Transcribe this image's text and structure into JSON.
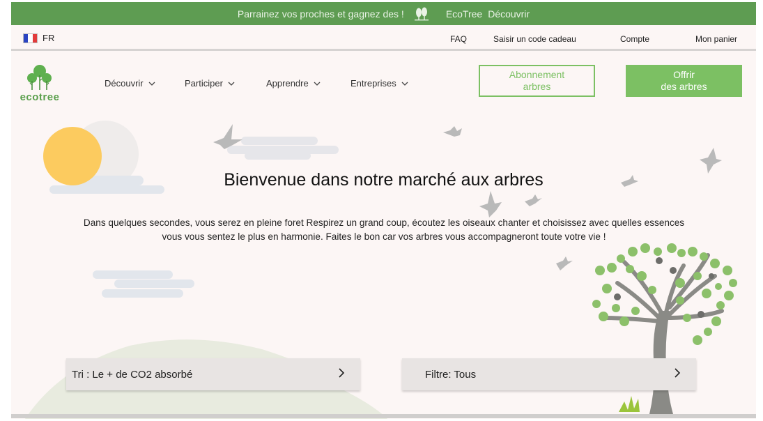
{
  "promo": {
    "text": "Parrainez vos proches et gagnez des !",
    "brand": "EcoTree",
    "link": "Découvrir"
  },
  "util": {
    "lang": "FR",
    "faq": "FAQ",
    "gift_code": "Saisir un code cadeau",
    "account": "Compte",
    "cart": "Mon panier"
  },
  "logo": {
    "text": "ecotree"
  },
  "nav": {
    "items": [
      {
        "label": "Découvrir"
      },
      {
        "label": "Participer"
      },
      {
        "label": "Apprendre"
      },
      {
        "label": "Entreprises"
      }
    ],
    "subscribe_line1": "Abonnement",
    "subscribe_line2": "arbres",
    "offer_line1": "Offrir",
    "offer_line2": "des arbres"
  },
  "hero": {
    "title": "Bienvenue dans notre marché aux arbres",
    "text_line1": "Dans quelques secondes, vous serez en pleine foret Respirez un grand coup, écoutez les oiseaux chanter et choisissez avec quelles essences",
    "text_line2": "vous vous sentez le plus en harmonie. Faites le bon car vos arbres vous accompagneront toute votre vie !"
  },
  "sort": {
    "label": "Tri : Le + de CO2 absorbé"
  },
  "filter": {
    "label": "Filtre: Tous"
  },
  "colors": {
    "brand_green": "#5e9c52",
    "accent_green": "#7cc063",
    "background": "#fcf6f5",
    "sun": "#fccb5f"
  },
  "icons": [
    "france-flag-icon",
    "tree-pair-icon",
    "chevron-down-icon",
    "chevron-right-icon",
    "bird-icon",
    "sun-icon",
    "tree-illustration"
  ]
}
